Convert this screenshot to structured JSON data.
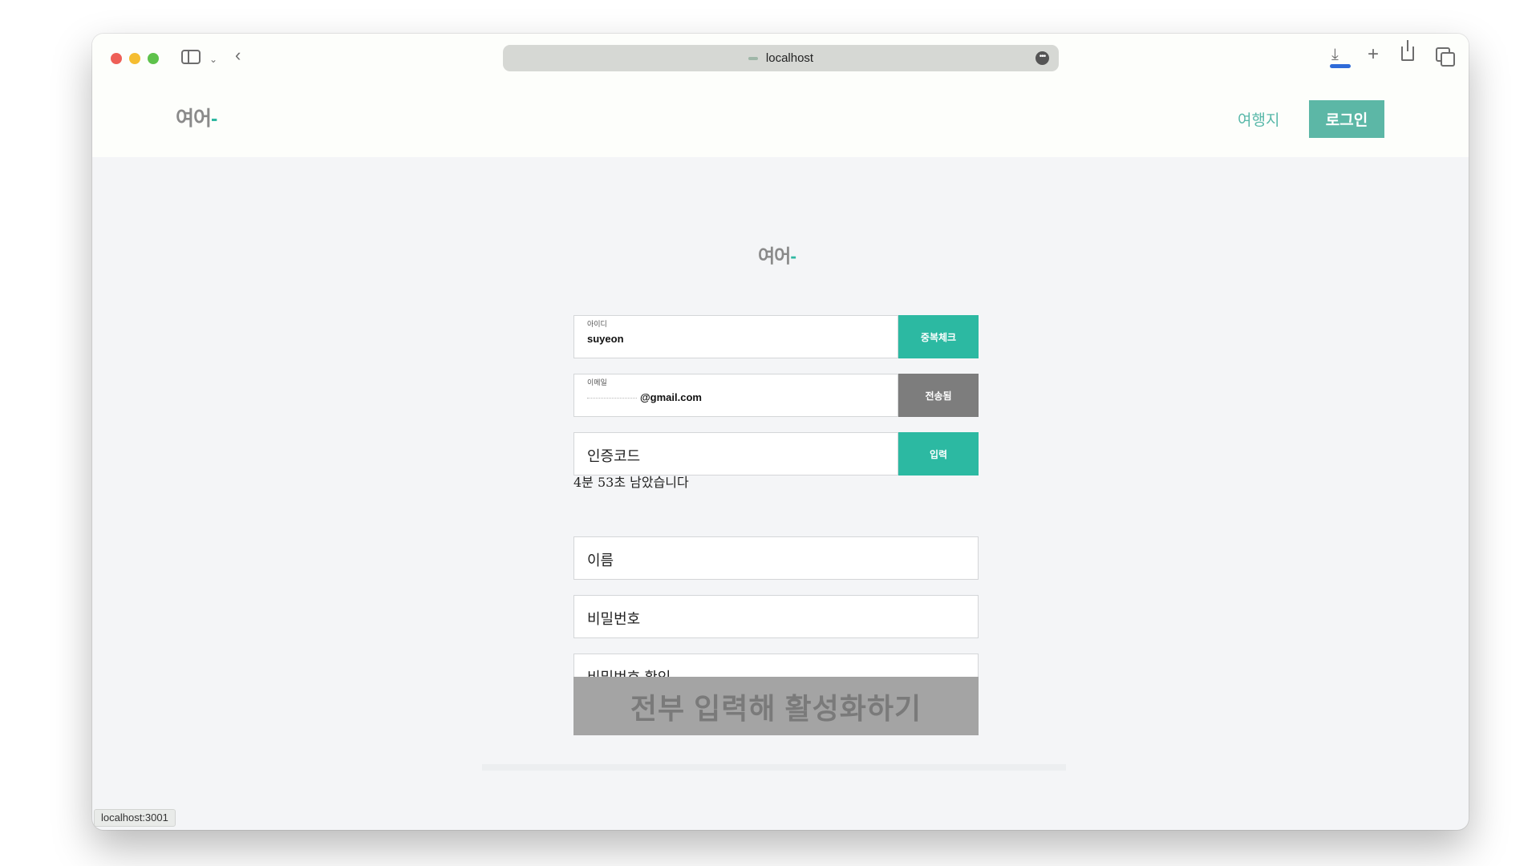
{
  "browser": {
    "url": "localhost",
    "status_url": "localhost:3001"
  },
  "header": {
    "logo_part1": "여어",
    "logo_part2": "-",
    "nav_link": "여행지",
    "login_button": "로그인"
  },
  "form": {
    "logo_part1": "여어",
    "logo_part2": "-",
    "id_field": {
      "label": "아이디",
      "value": "suyeon",
      "button": "중복체크"
    },
    "email_field": {
      "label": "이메일",
      "value_suffix": "@gmail.com",
      "button": "전송됨"
    },
    "code_field": {
      "placeholder": "인증코드",
      "button": "입력"
    },
    "timer_text": "4분 53초 남았습니다",
    "name_field": {
      "placeholder": "이름"
    },
    "password_field": {
      "placeholder": "비밀번호"
    },
    "password_confirm_field": {
      "placeholder": "비밀번호 확인"
    },
    "submit_button": "전부 입력해 활성화하기"
  },
  "colors": {
    "accent": "#2cb9a2",
    "login_button": "#5cb7a6",
    "sent_button": "#7d7d7d",
    "submit_disabled": "#a4a4a4"
  },
  "icons": [
    "sidebar-icon",
    "chevron-down-icon",
    "back-icon",
    "more-icon",
    "download-icon",
    "plus-icon",
    "share-icon",
    "tabs-icon"
  ]
}
